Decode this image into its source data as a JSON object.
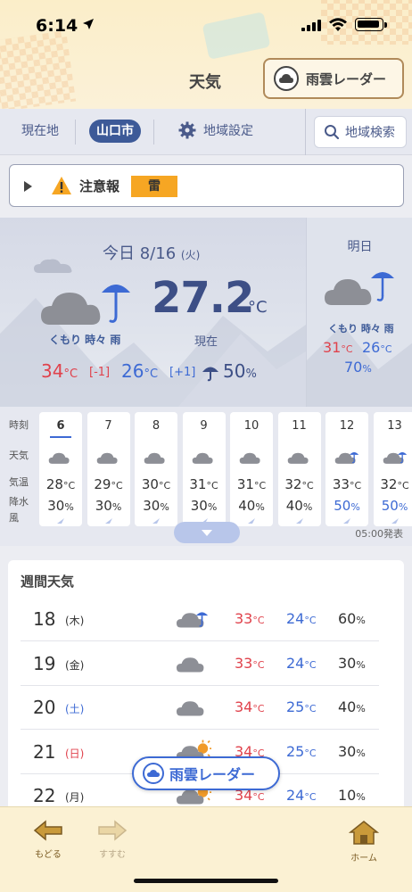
{
  "status": {
    "time": "6:14"
  },
  "header": {
    "title": "天気",
    "radar_button": "雨雲レーダー"
  },
  "tabs": {
    "current_location": "現在地",
    "selected_city": "山口市",
    "region_settings": "地域設定",
    "region_search": "地域検索"
  },
  "warning": {
    "label": "注意報",
    "badge": "雷",
    "badge_color": "#f6a623"
  },
  "today": {
    "date": "今日 8/16",
    "dow": "(火)",
    "condition": "くもり 時々 雨",
    "temperature": "27.2",
    "temperature_unit": "°C",
    "now_label": "現在",
    "high": "34",
    "high_diff": "[-1]",
    "low": "26",
    "low_diff": "[+1]",
    "pop": "50",
    "unit_c": "°C",
    "unit_pct": "%"
  },
  "tomorrow": {
    "title": "明日",
    "condition": "くもり 時々 雨",
    "high": "31",
    "low": "26",
    "pop": "70"
  },
  "hourly": {
    "labels": {
      "time": "時刻",
      "weather": "天気",
      "temp": "気温",
      "precip": "降水",
      "wind": "風"
    },
    "issued": "05:00発表",
    "hours": [
      {
        "hour": "6",
        "temp": "28",
        "pop": "30",
        "icon": "cloud-icon"
      },
      {
        "hour": "7",
        "temp": "29",
        "pop": "30",
        "icon": "cloud-icon"
      },
      {
        "hour": "8",
        "temp": "30",
        "pop": "30",
        "icon": "cloud-icon"
      },
      {
        "hour": "9",
        "temp": "31",
        "pop": "30",
        "icon": "cloud-icon"
      },
      {
        "hour": "10",
        "temp": "31",
        "pop": "40",
        "icon": "cloud-icon"
      },
      {
        "hour": "11",
        "temp": "32",
        "pop": "40",
        "icon": "cloud-icon"
      },
      {
        "hour": "12",
        "temp": "33",
        "pop": "50",
        "icon": "cloud-rain-icon"
      },
      {
        "hour": "13",
        "temp": "32",
        "pop": "50",
        "icon": "cloud-rain-icon"
      }
    ]
  },
  "weekly": {
    "title": "週間天気",
    "days": [
      {
        "day": "18",
        "dow": "(木)",
        "high": "33",
        "low": "24",
        "pop": "60",
        "icon": "cloud-rain-icon",
        "type": "weekday"
      },
      {
        "day": "19",
        "dow": "(金)",
        "high": "33",
        "low": "24",
        "pop": "30",
        "icon": "cloud-icon",
        "type": "weekday"
      },
      {
        "day": "20",
        "dow": "(土)",
        "high": "34",
        "low": "25",
        "pop": "40",
        "icon": "cloud-icon",
        "type": "saturday"
      },
      {
        "day": "21",
        "dow": "(日)",
        "high": "34",
        "low": "25",
        "pop": "30",
        "icon": "cloud-sun-icon",
        "type": "holiday"
      },
      {
        "day": "22",
        "dow": "(月)",
        "high": "34",
        "low": "24",
        "pop": "10",
        "icon": "cloud-sun-icon",
        "type": "weekday"
      }
    ]
  },
  "floating_radar": "雨雲レーダー",
  "bottom": {
    "back": "もどる",
    "forward": "すすむ",
    "home": "ホーム"
  },
  "colors": {
    "accent": "#3d5a98",
    "high": "#e0424c",
    "low": "#3d6ad4",
    "header_bg": "#fbeec9"
  }
}
